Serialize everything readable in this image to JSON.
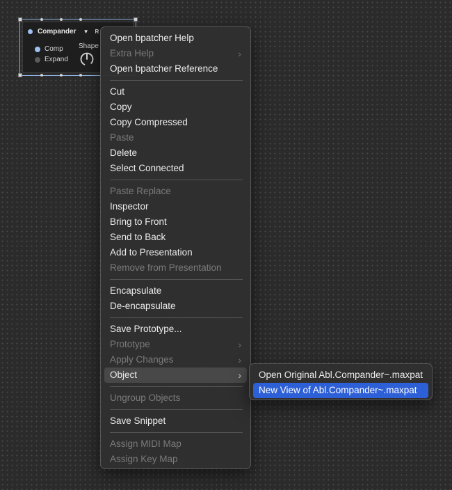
{
  "bpatcher": {
    "title": "Compander",
    "dropdown_glyph": "▼",
    "r_label": "R",
    "options": [
      "Comp",
      "Expand"
    ],
    "shape_label": "Shape",
    "accent": "#9ec0f0"
  },
  "menu": {
    "items": [
      {
        "label": "Open bpatcher Help",
        "disabled": false
      },
      {
        "label": "Extra Help",
        "disabled": true,
        "submenu": true
      },
      {
        "label": "Open bpatcher Reference",
        "disabled": false
      },
      {
        "label": "Cut",
        "disabled": false
      },
      {
        "label": "Copy",
        "disabled": false
      },
      {
        "label": "Copy Compressed",
        "disabled": false
      },
      {
        "label": "Paste",
        "disabled": true
      },
      {
        "label": "Delete",
        "disabled": false
      },
      {
        "label": "Select Connected",
        "disabled": false
      },
      {
        "label": "Paste Replace",
        "disabled": true
      },
      {
        "label": "Inspector",
        "disabled": false
      },
      {
        "label": "Bring to Front",
        "disabled": false
      },
      {
        "label": "Send to Back",
        "disabled": false
      },
      {
        "label": "Add to Presentation",
        "disabled": false
      },
      {
        "label": "Remove from Presentation",
        "disabled": true
      },
      {
        "label": "Encapsulate",
        "disabled": false
      },
      {
        "label": "De-encapsulate",
        "disabled": false
      },
      {
        "label": "Save Prototype...",
        "disabled": false
      },
      {
        "label": "Prototype",
        "disabled": true,
        "submenu": true
      },
      {
        "label": "Apply Changes",
        "disabled": true,
        "submenu": true
      },
      {
        "label": "Object",
        "disabled": false,
        "submenu": true,
        "active": true
      },
      {
        "label": "Ungroup Objects",
        "disabled": true
      },
      {
        "label": "Save Snippet",
        "disabled": false
      },
      {
        "label": "Assign MIDI Map",
        "disabled": true
      },
      {
        "label": "Assign Key Map",
        "disabled": true
      }
    ],
    "chevron_glyph": "›"
  },
  "submenu": {
    "items": [
      {
        "label": "Open Original Abl.Compander~.maxpat"
      },
      {
        "label": "New View of Abl.Compander~.maxpat",
        "selected": true
      }
    ]
  },
  "colors": {
    "canvas": "#2b2b2b",
    "menu_bg": "#303030",
    "selected": "#2d5fd6",
    "disabled_text": "#7b7b7b"
  }
}
